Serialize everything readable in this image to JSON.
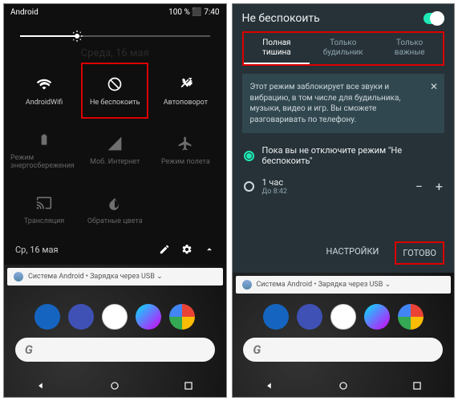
{
  "left": {
    "status": {
      "label": "Android",
      "right": "100 %  ⬛  7:40"
    },
    "date_behind": "Среда, 16 мая",
    "tiles": [
      {
        "label": "AndroidWifi",
        "iconName": "wifi-icon",
        "dim": false,
        "hl": false
      },
      {
        "label": "Не беспокоить",
        "iconName": "dnd-icon",
        "dim": false,
        "hl": true
      },
      {
        "label": "Автоповорот",
        "iconName": "rotate-icon",
        "dim": false,
        "hl": false
      },
      {
        "label": "Режим энергосбережения",
        "iconName": "battery-icon",
        "dim": true,
        "hl": false
      },
      {
        "label": "Моб. Интернет",
        "iconName": "signal-icon",
        "dim": true,
        "hl": false
      },
      {
        "label": "Режим полета",
        "iconName": "airplane-icon",
        "dim": true,
        "hl": false
      },
      {
        "label": "Трансляция",
        "iconName": "cast-icon",
        "dim": true,
        "hl": false
      },
      {
        "label": "Обратные цвета",
        "iconName": "invert-icon",
        "dim": true,
        "hl": false
      }
    ],
    "footer_date": "Ср, 16 мая",
    "notif": "Система Android • Зарядка через USB  ⌄",
    "search_letter": "G"
  },
  "right": {
    "title": "Не беспокоить",
    "tabs": [
      {
        "l1": "Полная",
        "l2": "тишина",
        "active": true
      },
      {
        "l1": "Только",
        "l2": "будильник",
        "active": false
      },
      {
        "l1": "Только",
        "l2": "важные",
        "active": false
      }
    ],
    "info": "Этот режим заблокирует все звуки и вибрацию, в том числе для будильника, музыки, видео и игр. Вы сможете разговаривать по телефону.",
    "options": [
      {
        "text": "Пока вы не отключите режим \"Не беспокоить\"",
        "sub": "",
        "checked": true,
        "stepper": false
      },
      {
        "text": "1 час",
        "sub": "До 8:42",
        "checked": false,
        "stepper": true
      }
    ],
    "settings": "НАСТРОЙКИ",
    "done": "ГОТОВО",
    "notif": "Система Android • Зарядка через USB  ⌄",
    "search_letter": "G"
  }
}
